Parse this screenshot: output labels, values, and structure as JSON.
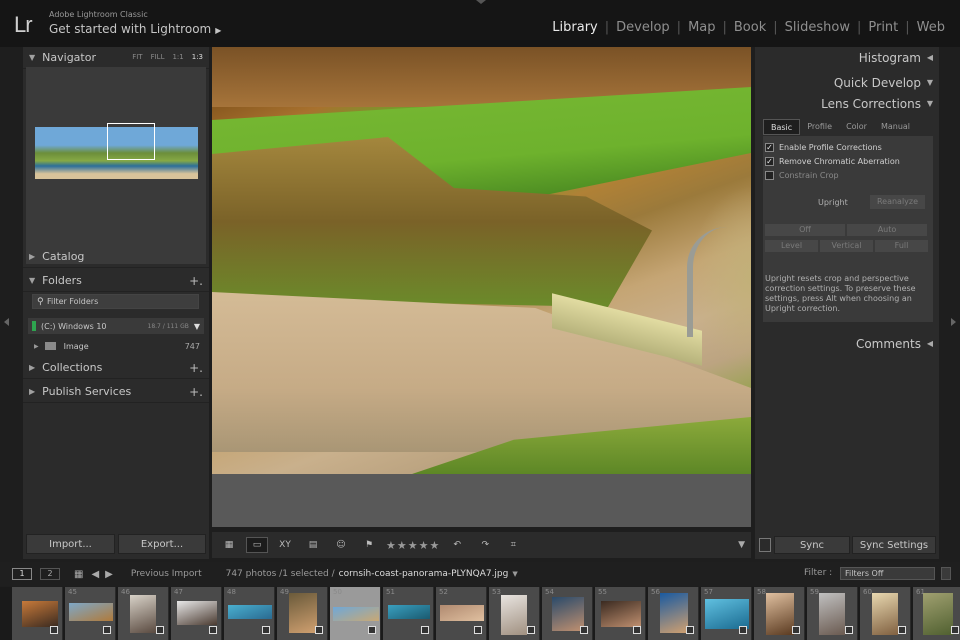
{
  "header": {
    "logo": "Lr",
    "app_name": "Adobe Lightroom Classic",
    "subtitle": "Get started with Lightroom",
    "modules": [
      "Library",
      "Develop",
      "Map",
      "Book",
      "Slideshow",
      "Print",
      "Web"
    ],
    "active_module": "Library"
  },
  "left": {
    "navigator": {
      "label": "Navigator",
      "options": [
        "FIT",
        "FILL",
        "1:1",
        "1:3"
      ],
      "active_option": "1:3"
    },
    "catalog_label": "Catalog",
    "folders_label": "Folders",
    "filter_placeholder": "Filter Folders",
    "drive": {
      "name": "(C:) Windows 10",
      "size": "18.7 / 111 GB"
    },
    "folder": {
      "name": "Image",
      "count": "747"
    },
    "collections_label": "Collections",
    "publish_label": "Publish Services",
    "import_label": "Import...",
    "export_label": "Export..."
  },
  "toolbar": {
    "stars": "★★★★★",
    "xy": "XY"
  },
  "right": {
    "histogram_label": "Histogram",
    "quick_develop_label": "Quick Develop",
    "lens_label": "Lens Corrections",
    "tabs": [
      "Basic",
      "Profile",
      "Color",
      "Manual"
    ],
    "active_tab": "Basic",
    "checks": [
      {
        "label": "Enable Profile Corrections",
        "checked": true
      },
      {
        "label": "Remove Chromatic Aberration",
        "checked": true
      },
      {
        "label": "Constrain Crop",
        "checked": false
      }
    ],
    "upright_label": "Upright",
    "reanalyze_label": "Reanalyze",
    "upright_buttons": [
      "Off",
      "Auto",
      "Level",
      "Vertical",
      "Full"
    ],
    "note": "Upright resets crop and perspective correction settings. To preserve these settings, press Alt when choosing an Upright correction.",
    "comments_label": "Comments",
    "sync_label": "Sync",
    "sync_settings_label": "Sync Settings"
  },
  "filmstrip_header": {
    "view1": "1",
    "view2": "2",
    "source": "Previous Import",
    "count": "747 photos /1 selected /",
    "filename": "cornsih-coast-panorama-PLYNQA7.jpg",
    "filter_label": "Filter :",
    "filter_value": "Filters Off"
  },
  "filmstrip": {
    "numbers": [
      "",
      "45",
      "46",
      "47",
      "48",
      "49",
      "50",
      "51",
      "52",
      "53",
      "54",
      "55",
      "56",
      "57",
      "58",
      "59",
      "60",
      "61"
    ],
    "selected_index": 6
  },
  "colors": {
    "background": "#1e1e1e",
    "panel": "#2b2b2b",
    "active_text": "#eaeaea",
    "drive_indicator": "#2ea44f"
  }
}
